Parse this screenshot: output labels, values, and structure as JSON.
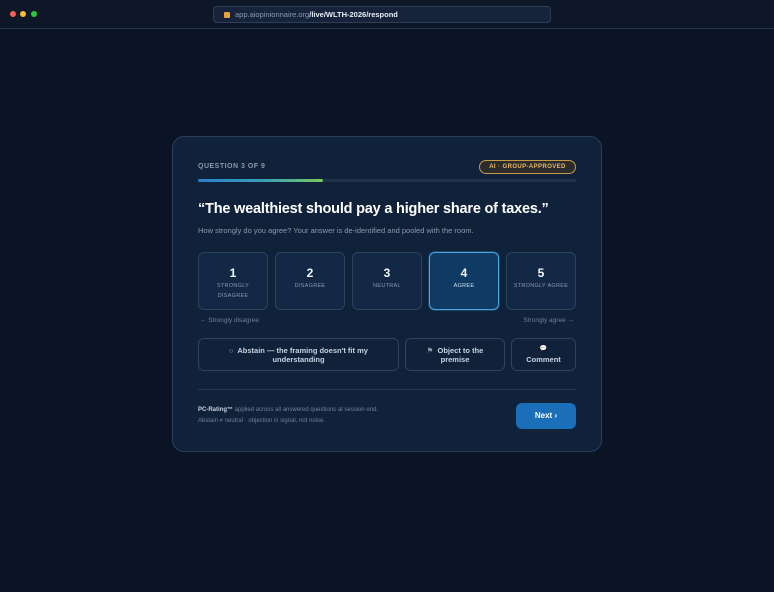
{
  "browser": {
    "url_host": "app.aiopinionnaire.org",
    "url_path": "/live/WLTH-2026/respond"
  },
  "question": {
    "counter": "QUESTION 3 OF 9",
    "badge": "AI · GROUP-APPROVED",
    "progress": 0.33,
    "prompt": "“The wealthiest should pay a higher share of taxes.”",
    "subtext": "How strongly do you agree? Your answer is de-identified and pooled with the room."
  },
  "scale": {
    "selected": 4,
    "options": [
      {
        "num": "1",
        "label": "STRONGLY DISAGREE"
      },
      {
        "num": "2",
        "label": "DISAGREE"
      },
      {
        "num": "3",
        "label": "NEUTRAL"
      },
      {
        "num": "4",
        "label": "AGREE"
      },
      {
        "num": "5",
        "label": "STRONGLY AGREE"
      }
    ],
    "left_anchor": "← Strongly disagree",
    "right_anchor": "Strongly agree →"
  },
  "alternatives": {
    "abstain": {
      "icon": "○",
      "label": "Abstain — the framing doesn't fit my understanding"
    },
    "object": {
      "icon": "⚑",
      "label": "Object to the premise"
    },
    "comment": {
      "icon": "💬",
      "label": "Comment"
    }
  },
  "footer": {
    "rating_name": "PC-Rating™",
    "rating_text": " applied across all answered questions at session end.",
    "note": "Abstain ≠ neutral · objection is signal, not noise.",
    "next_label": "Next ›"
  },
  "colors": {
    "background": "#0b1424",
    "card": "#10213a",
    "accent": "#1a6fb8",
    "selected_border": "#46a7e4",
    "badge": "#e7b968"
  }
}
